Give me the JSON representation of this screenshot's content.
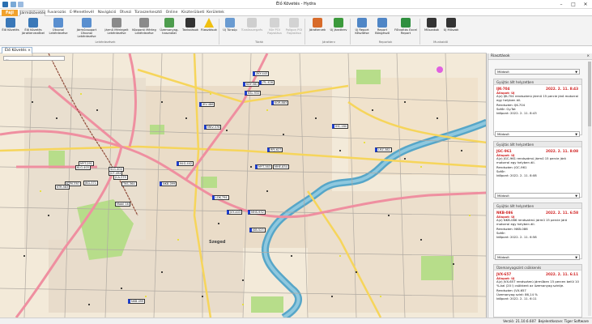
{
  "window": {
    "title": "Élő Követés - Hydra"
  },
  "ribbon_tabs": {
    "file": "Fájl",
    "items": [
      "Járműkövetés",
      "Fuvarozás",
      "E-Menetlevél",
      "Navigáció",
      "Ütvezi",
      "Túraszerkesztő",
      "Online",
      "Kiszterülaeti",
      "Kerületek"
    ]
  },
  "ribbon": {
    "buttons": [
      {
        "label": "Élő Követés"
      },
      {
        "label": "Élő Követés Járattervezőbel"
      },
      {
        "label": "Útvonal Lekérdezése"
      },
      {
        "label": "Járműcsoport Útvonal Lekérdezése"
      },
      {
        "label": "Jármű Mérlegelt Lekérdezése"
      },
      {
        "label": "Központi Mérleg Lekérdezése"
      },
      {
        "label": "Üzemanyag-használat"
      },
      {
        "label": "Tankolások"
      },
      {
        "label": "Riasztások"
      },
      {
        "label": "Új Túraúp"
      },
      {
        "label": "Túraösszegzés"
      },
      {
        "label": "Kör POI Rajzolása"
      },
      {
        "label": "Poligon POI Rajzolása"
      },
      {
        "label": "Járattervek"
      },
      {
        "label": "Új Járatterv"
      },
      {
        "label": "Új Report Készítése"
      },
      {
        "label": "Report Böngésző"
      },
      {
        "label": "Fűtvaltás Excel Report"
      },
      {
        "label": "Műszakok"
      },
      {
        "label": "Új Műszak"
      }
    ],
    "groups": {
      "g1": "Lekérdezések",
      "g2": "Túrák",
      "g3": "Járatterv",
      "g4": "Reportok",
      "g5": "Munkaidő"
    }
  },
  "doc_tab": {
    "label": "Élő Követés"
  },
  "map": {
    "filter_value": "...",
    "city": "Szeged",
    "vehicle_labels": [
      "ZKY-443",
      "JTL-428",
      "KDY-582",
      "KSL-932",
      "KGR-883",
      "JKV-486",
      "MKV-376",
      "IHC-180",
      "LRZ-382",
      "RPJ-627",
      "MYT-291",
      "KLG-403",
      "NLG-442",
      "JCF-494",
      "SLG-404",
      "JCA-379",
      "TKS-364",
      "NKB-099",
      "JKG-371",
      "KZM-330",
      "KTR-583",
      "LDK-794",
      "JVY-403",
      "MYT-383",
      "MHS-932",
      "JSB-523",
      "MHE-834",
      "Mobil 16",
      "NKB-099"
    ]
  },
  "side": {
    "title": "Riasztások",
    "dropdown_label": "Módosít",
    "cards": [
      {
        "type": "Gyújtás állt helyzetben",
        "plate": "IJK-704",
        "time": "2022. 2. 11. 8:43",
        "status": "Állapot: Új",
        "desc": "A(z) IJK-704 rendszámú jármű 15 percie járó motorral egy helyben áll.",
        "reg": "Rendszám: IJK-704",
        "driver": "Sofőr: Gy.Tot",
        "when": "Időpont: 2022. 2. 11. 8:43"
      },
      {
        "type": "Gyújtás állt helyzetben",
        "plate": "JGC-961",
        "time": "2022. 2. 11. 8:08",
        "status": "Állapot: Új",
        "desc": "A(z) JGC-961 rendszámú jármű 15 percie járó motorral egy helyben áll.",
        "reg": "Rendszám: JGC-961",
        "driver": "Sofőr:",
        "when": "Időpont: 2022. 2. 11. 8:08"
      },
      {
        "type": "Gyújtás állt helyzetben",
        "plate": "NKB-086",
        "time": "2022. 2. 11. 6:58",
        "status": "Állapot: Új",
        "desc": "A(z) NKB-086 rendszámú jármű 15 percie járó motorral egy helyben áll.",
        "reg": "Rendszám: NKB-086",
        "driver": "Sofőr:",
        "when": "Időpont: 2022. 2. 11. 6:58"
      },
      {
        "type": "Üzemanyagszint csökkenés",
        "plate": "JVX-657",
        "time": "2022. 2. 11. 6:11",
        "status": "Állapot: Új",
        "desc": "A(z) JVX-657 rendszámú járműben 15 percen belül 10 %-kal (20 l) csökkent az üzemanyag szintje.",
        "reg": "Rendszám: JVX-657",
        "driver": "Üzemanyag szint: 86,14 %",
        "when": "Időpont: 2022. 2. 11. 6:11"
      }
    ]
  },
  "status": {
    "version": "Verzió: 21.10.6.607",
    "user": "Bejelentkezve: Tiger Software"
  },
  "colors": {
    "accent": "#f1a22d",
    "alert_red": "#d02020",
    "river": "#56a6c8",
    "park": "#b7dd8a",
    "road_main": "#ef8fa0",
    "road_yellow": "#f6d55b",
    "marker_blue": "#1e3fd0"
  }
}
